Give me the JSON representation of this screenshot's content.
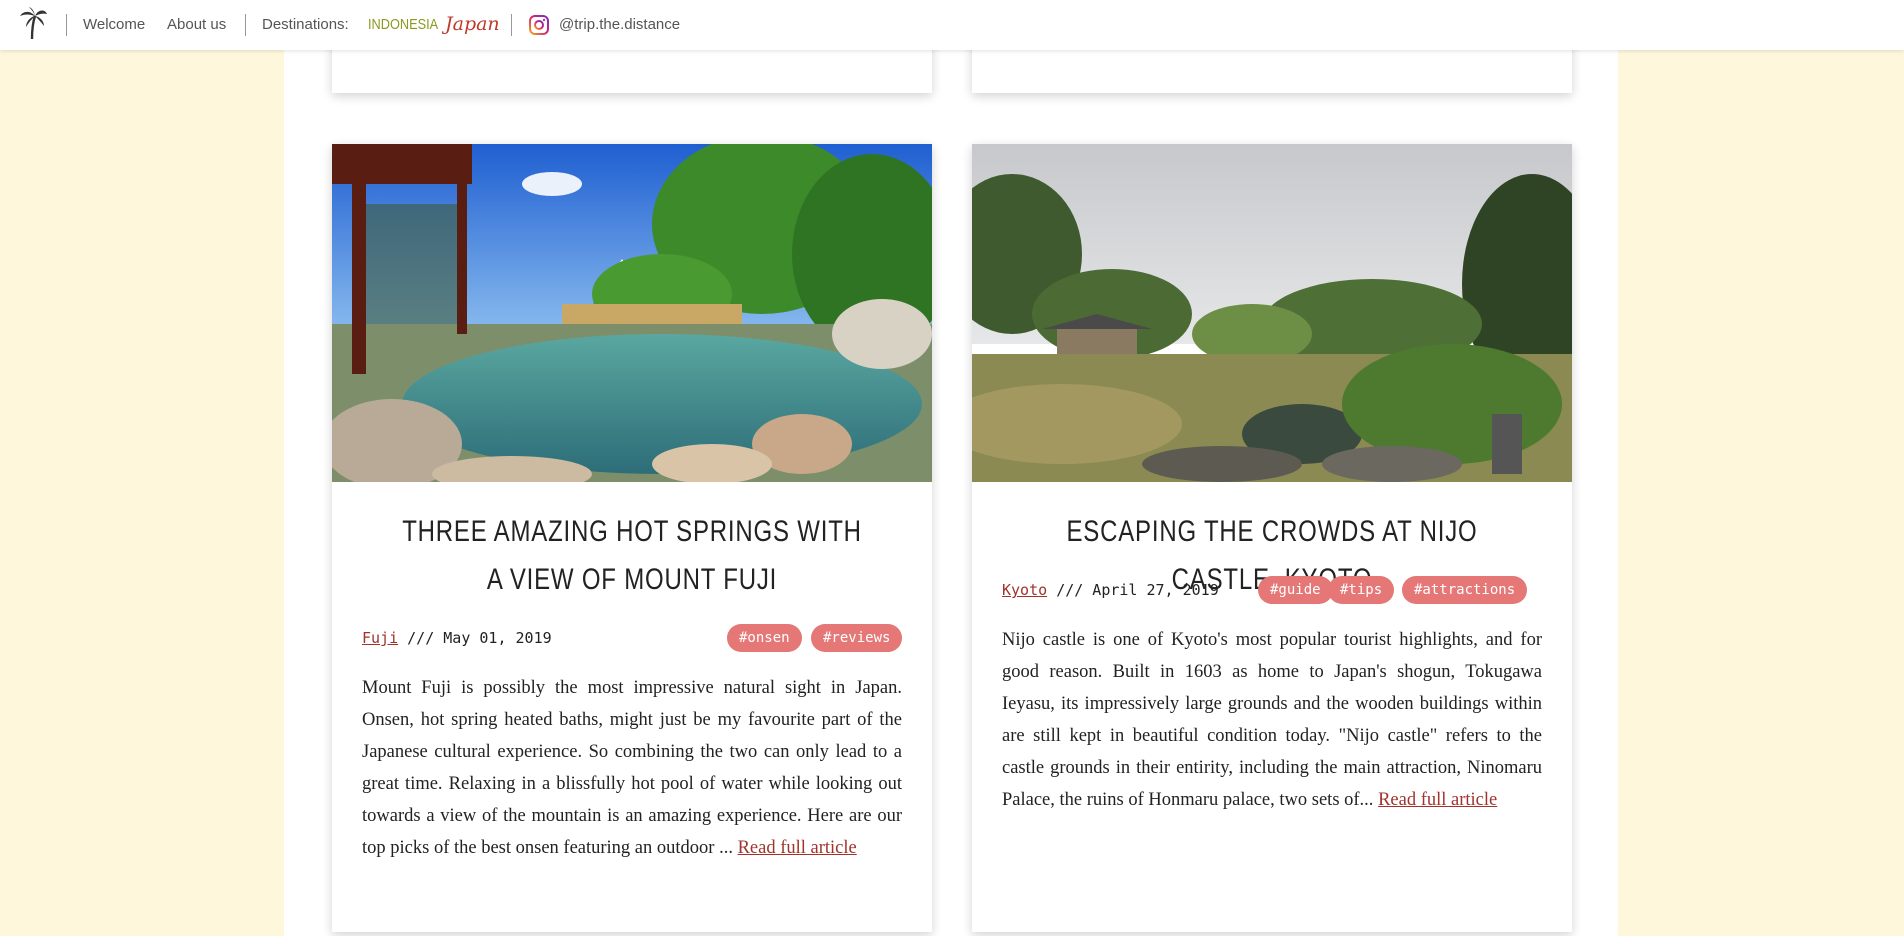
{
  "nav": {
    "welcome": "Welcome",
    "about": "About us",
    "destinations_label": "Destinations:",
    "dest_indonesia": "INDONESIA",
    "dest_japan": "Japan",
    "instagram_handle": "@trip.the.distance"
  },
  "posts": [
    {
      "title": "THREE AMAZING HOT SPRINGS WITH A VIEW OF MOUNT FUJI",
      "location": "Fuji",
      "date": "/// May 01, 2019",
      "tags": [
        "#onsen",
        "#reviews"
      ],
      "excerpt": "Mount Fuji is possibly the most impressive natural sight in Japan. Onsen, hot spring heated baths, might just be my favourite part of the Japanese cultural experience. So combining the two can only lead to a great time. Relaxing in a blissfully hot pool of water while looking out towards a view of the mountain is an amazing experience. Here are our top picks of the best onsen featuring an outdoor ...",
      "read_more": "Read full article",
      "image": "onsen-with-mount-fuji-photo"
    },
    {
      "title": "ESCAPING THE CROWDS AT NIJO CASTLE, KYOTO",
      "location": "Kyoto",
      "date": "/// April 27, 2019",
      "tags": [
        "#guide",
        "#tips",
        "#attractions"
      ],
      "excerpt": "Nijo castle is one of Kyoto's most popular tourist highlights, and for good reason. Built in 1603 as home to Japan's shogun, Tokugawa Ieyasu, its impressively large grounds and the wooden buildings within are still kept in beautiful condition today. \"Nijo castle\" refers to the castle grounds in their entirity, including the main attraction, Ninomaru Palace, the ruins of Honmaru palace, two sets of...",
      "read_more": "Read full article",
      "image": "nijo-castle-garden-photo"
    }
  ],
  "colors": {
    "page_bg": "#fef7dc",
    "tag_bg": "#e57777",
    "link": "#a0332b",
    "indonesia": "#8a9a1c",
    "japan": "#c0392b"
  }
}
